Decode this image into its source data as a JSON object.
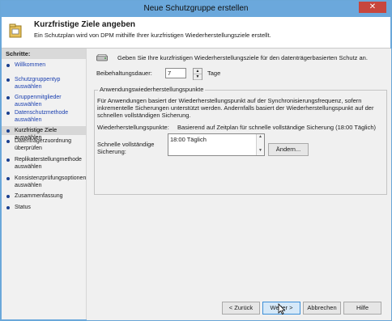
{
  "window": {
    "title": "Neue Schutzgruppe erstellen",
    "close_glyph": "✕"
  },
  "header": {
    "title": "Kurzfristige Ziele angeben",
    "subtitle": "Ein Schutzplan wird von DPM mithilfe Ihrer kurzfristigen Wiederherstellungsziele erstellt."
  },
  "sidebar": {
    "heading": "Schritte:",
    "steps": [
      {
        "label": "Willkommen",
        "state": "link"
      },
      {
        "label": "Schutzgruppentyp auswählen",
        "state": "link"
      },
      {
        "label": "Gruppenmitglieder auswählen",
        "state": "link"
      },
      {
        "label": "Datenschutzmethode auswählen",
        "state": "link"
      },
      {
        "label": "Kurzfristige Ziele auswählen",
        "state": "current"
      },
      {
        "label": "Datenträgerzuordnung überprüfen",
        "state": "pending"
      },
      {
        "label": "Replikaterstellungmethode auswählen",
        "state": "pending"
      },
      {
        "label": "Konsistenzprüfungsoptionen auswählen",
        "state": "pending"
      },
      {
        "label": "Zusammenfassung",
        "state": "pending"
      },
      {
        "label": "Status",
        "state": "pending"
      }
    ]
  },
  "main": {
    "intro": "Geben Sie Ihre kurzfristigen Wiederherstellungsziele für den datenträgerbasierten Schutz an.",
    "retention": {
      "label": "Beibehaltungsdauer:",
      "value": "7",
      "unit": "Tage"
    },
    "group": {
      "legend": "Anwendungswiederherstellungspunkte",
      "description": "Für Anwendungen basiert der Wiederherstellungspunkt auf der Synchronisierungsfrequenz, sofern inkrementelle Sicherungen unterstützt werden. Andernfalls basiert der Wiederherstellungspunkt auf der schnellen vollständigen Sicherung.",
      "recovery_points_label": "Wiederherstellungspunkte:",
      "recovery_points_value": "Basierend auf Zeitplan für schnelle vollständige Sicherung (18:00 Täglich)",
      "full_backup_label": "Schnelle vollständige Sicherung:",
      "full_backup_schedule": "18:00 Täglich",
      "change_button": "Ändern..."
    }
  },
  "footer": {
    "back": "< Zurück",
    "next": "Weiter >",
    "cancel": "Abbrechen",
    "help": "Hilfe"
  },
  "colors": {
    "titlebar": "#6ba8dc",
    "close": "#c7463d",
    "link": "#1a3fb0",
    "default_button": "#3c8fd8"
  }
}
